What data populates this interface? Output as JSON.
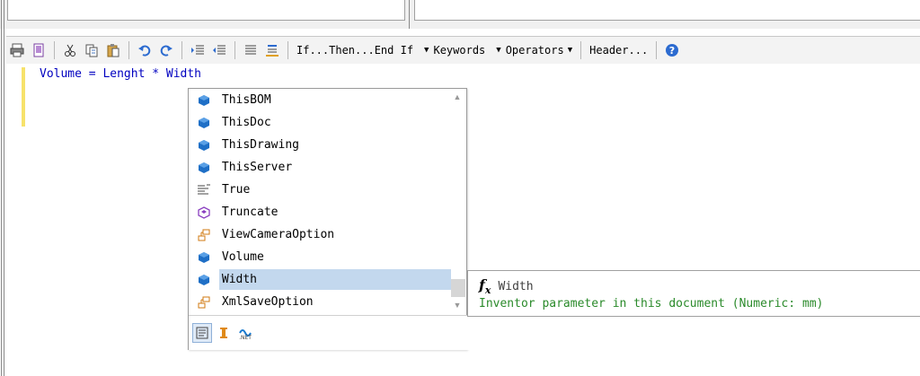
{
  "toolbar": {
    "ifthen_label": "If...Then...End If",
    "keywords_label": "Keywords",
    "operators_label": "Operators",
    "header_label": "Header..."
  },
  "editor": {
    "code": "Volume = Lenght * Width"
  },
  "autocomplete": {
    "items": [
      {
        "label": "ThisBOM",
        "icon": "blue-object-icon"
      },
      {
        "label": "ThisDoc",
        "icon": "blue-object-icon"
      },
      {
        "label": "ThisDrawing",
        "icon": "blue-object-icon"
      },
      {
        "label": "ThisServer",
        "icon": "blue-object-icon"
      },
      {
        "label": "True",
        "icon": "keyword-icon"
      },
      {
        "label": "Truncate",
        "icon": "method-icon"
      },
      {
        "label": "ViewCameraOption",
        "icon": "enum-icon"
      },
      {
        "label": "Volume",
        "icon": "blue-object-icon"
      },
      {
        "label": "Width",
        "icon": "blue-object-icon"
      },
      {
        "label": "XmlSaveOption",
        "icon": "enum-icon"
      }
    ],
    "selected_index": 8
  },
  "tooltip": {
    "fx": "f",
    "fx_sub": "x",
    "title": "Width",
    "description": "Inventor parameter in this document (Numeric: mm)"
  },
  "colors": {
    "code": "#0000c0",
    "selection": "#c3d8ee",
    "tooltip_desc": "#2a8a2a"
  }
}
